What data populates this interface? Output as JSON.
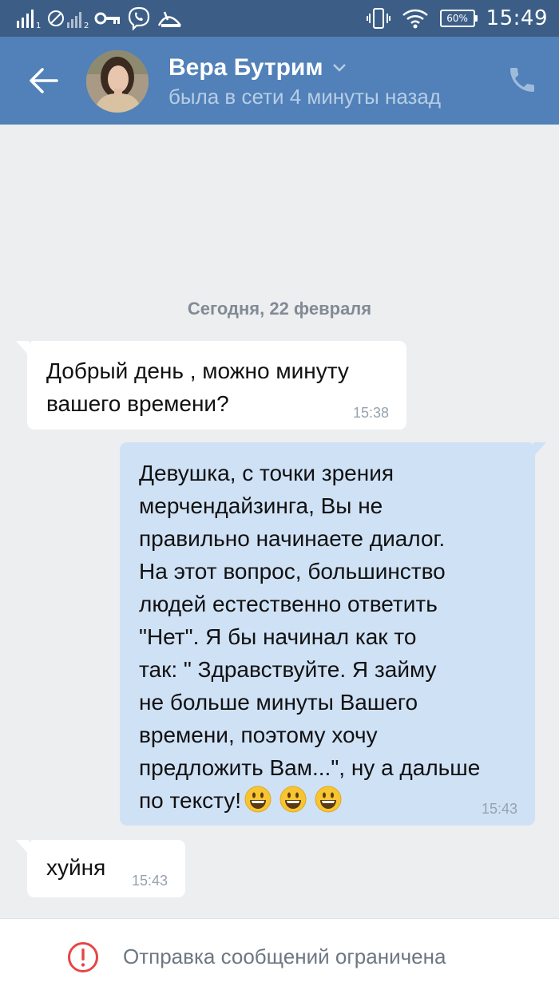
{
  "status_bar": {
    "time": "15:49",
    "battery": "60%",
    "icons": [
      "signal-icon",
      "no-sim-icon",
      "signal-2-icon",
      "key-icon",
      "viber-icon",
      "call-activity-icon",
      "vibrate-icon",
      "wifi-icon",
      "battery-icon"
    ]
  },
  "header": {
    "name": "Вера Бутрим",
    "status": "была в сети 4 минуты назад"
  },
  "chat": {
    "date": "Сегодня, 22 февраля",
    "messages": [
      {
        "direction": "in",
        "lines": [
          "Добрый день , можно минуту",
          "вашего времени?"
        ],
        "time": "15:38"
      },
      {
        "direction": "out",
        "lines": [
          "Девушка, с точки зрения",
          "мерчендайзинга, Вы не",
          "правильно начинаете диалог.",
          "На этот вопрос, большинство",
          "людей естественно ответить",
          "\"Нет\". Я бы начинал как то",
          "так: \" Здравствуйте. Я займу",
          "не больше минуты Вашего",
          "времени, поэтому хочу",
          "предложить Вам...\", ну а дальше",
          "по тексту!"
        ],
        "time": "15:43"
      },
      {
        "direction": "in",
        "lines": [
          "хуйня"
        ],
        "time": "15:43"
      }
    ]
  },
  "bottom": {
    "restriction_text": "Отправка сообщений ограничена"
  },
  "colors": {
    "header": "#5181b8",
    "status_bar": "#3c5e86",
    "background": "#edeef0",
    "outgoing_bubble": "#cfe1f5",
    "incoming_bubble": "#ffffff",
    "alert": "#e64646"
  }
}
